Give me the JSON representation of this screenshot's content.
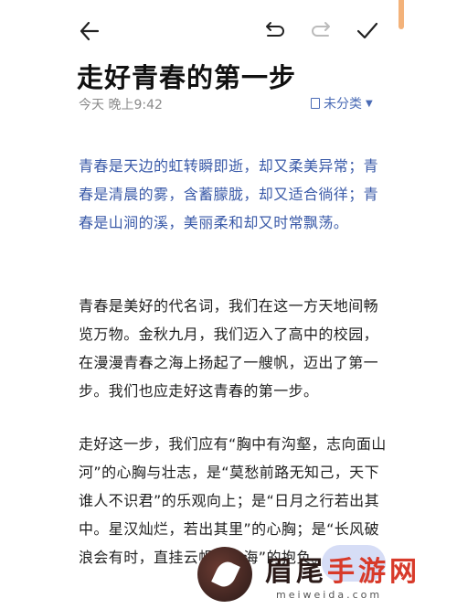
{
  "toolbar": {
    "back_icon": "arrow-left-icon",
    "undo_icon": "undo-icon",
    "redo_icon": "redo-icon",
    "done_icon": "check-icon"
  },
  "note": {
    "title": "走好青春的第一步",
    "time": "今天 晚上9:42",
    "category": "未分类"
  },
  "paragraphs": [
    "青春是天边的虹转瞬即逝，却又柔美异常；青春是清晨的雾，含蓄朦胧，却又适合徜徉；青春是山涧的溪，美丽柔和却又时常飘荡。",
    "青春是美好的代名词，我们在这一方天地间畅览万物。金秋九月，我们迈入了高中的校园，在漫漫青春之海上扬起了一艘帆，迈出了第一步。我们也应走好这青春的第一步。",
    "走好这一步，我们应有“胸中有沟壑，志向面山河”的心胸与壮志，是“莫愁前路无知己，天下谁人不识君”的乐观向上；是“日月之行若出其中。星汉灿烂，若出其里”的心胸；是“长风破浪会有时，直挂云帆济沧海”的抱负。"
  ],
  "watermark": {
    "text_main": "眉尾",
    "text_accent": "手游网",
    "sub": "meiweida.com"
  },
  "colors": {
    "accent": "#3a5aa8",
    "category": "#4a6bb5",
    "meta": "#8a8a8a"
  }
}
